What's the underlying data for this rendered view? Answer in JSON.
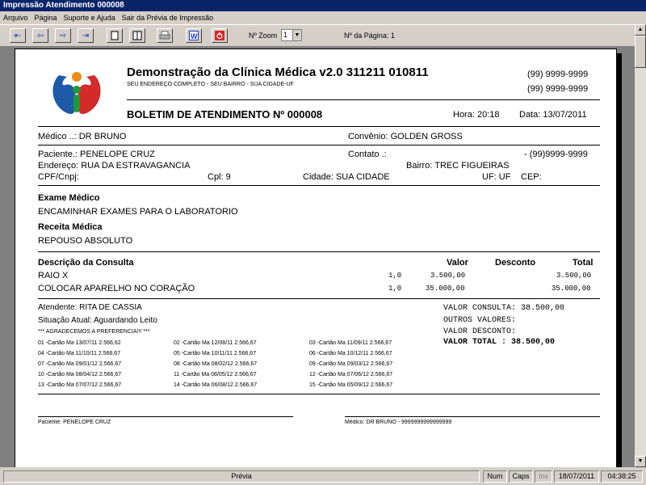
{
  "window": {
    "title": "Impressão Atendimento 000008"
  },
  "menu": [
    "Arquivo",
    "Página",
    "Suporte e Ajuda",
    "Sair da Prévia de Impressão"
  ],
  "toolbar": {
    "zoom_label": "Nº Zoom",
    "zoom_value": "1",
    "page_label": "Nº da Página: 1"
  },
  "report": {
    "clinic_name": "Demonstração da Clínica Médica v2.0 311211 010811",
    "address": "SEU ENDEREÇO COMPLETO - SEU BAIRRO - SUA CIDADE-UF",
    "phone1": "(99) 9999-9999",
    "phone2": "(99) 9999-9999",
    "bulletin": "BOLETIM DE ATENDIMENTO Nº 000008",
    "time": "Hora: 20:18",
    "date": "Data: 13/07/2011",
    "doctor": "Médico ..: DR BRUNO",
    "insurance": "Convênio: GOLDEN GROSS",
    "patient": "Paciente.: PENELOPE CRUZ",
    "contact": "Contato .:",
    "contact_phone": "- (99)9999-9999",
    "address_line": "Endereço: RUA DA ESTRAVAGANCIA",
    "neighborhood": "Bairro: TREC FIGUEIRAS",
    "cpf": "CPF/Cnpj:",
    "cpl": "Cpl: 9",
    "city": "Cidade: SUA CIDADE",
    "uf": "UF: UF",
    "cep": "CEP:",
    "exam_title": "Exame Médico",
    "exam_text": "ENCAMINHAR EXAMES PARA O LABORATORIO",
    "prescription_title": "Receita Médica",
    "prescription_text": "REPOUSO ABSOLUTO",
    "items_header": {
      "desc": "Descrição da Consulta",
      "value": "Valor",
      "discount": "Desconto",
      "total": "Total"
    },
    "items": [
      {
        "desc": "RAIO X",
        "qty": "1,0",
        "value": "3.500,00",
        "total": "3.500,00"
      },
      {
        "desc": "COLOCAR APARELHO NO CORAÇÃO",
        "qty": "1,0",
        "value": "35.000,00",
        "total": "35.000,00"
      }
    ],
    "attendant": "Atendente: RITA DE CASSIA",
    "situation": "Situação Atual: Aguardando Leito",
    "thanks": "*** AGRADECEMOS A PREFERENCIA!!! ***",
    "summary": [
      "VALOR CONSULTA: 38.500,00",
      "OUTROS VALORES:",
      "VALOR DESCONTO:",
      "VALOR TOTAL   : 38.500,00"
    ],
    "installments": [
      "01 -Cartão Ma 13/07/11  2.566,62",
      "02 -Cartão Ma 12/08/11  2.566,67",
      "03 -Cartão Ma 11/09/11  2.566,67",
      "04 -Cartão Ma 11/10/11  2.566,67",
      "05 -Cartão Ma 10/11/11  2.566,67",
      "06 -Cartão Ma 10/12/11  2.566,67",
      "07 -Cartão Ma 09/01/12  2.566,67",
      "08 -Cartão Ma 08/02/12  2.566,67",
      "09 -Cartão Ma 09/03/12  2.566,67",
      "10 -Cartão Ma 08/04/12  2.566,67",
      "11 -Cartão Ma 08/05/12  2.566,67",
      "12 -Cartão Ma 07/06/12  2.566,67",
      "13 -Cartão Ma 07/07/12  2.566,67",
      "14 -Cartão Ma 06/08/12  2.566,67",
      "15 -Cartão Ma 05/09/12  2.566,67"
    ],
    "sign_patient": "Paciente: PENELOPE CRUZ",
    "sign_doctor": "Médico: DR BRUNO - 9999999999999999"
  },
  "status": {
    "mode": "Prévia",
    "num": "Num",
    "caps": "Caps",
    "ins": "Ins",
    "date": "18/07/2011",
    "time": "04:38:25"
  }
}
